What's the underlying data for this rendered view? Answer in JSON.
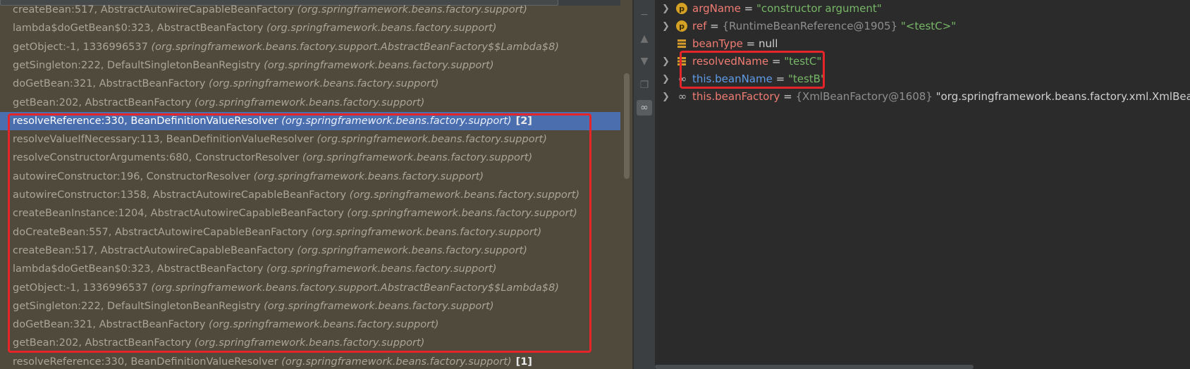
{
  "frames": [
    {
      "method": "createBean:517, AbstractAutowireCapableBeanFactory",
      "pkg": "(org.springframework.beans.factory.support)",
      "badge": ""
    },
    {
      "method": "lambda$doGetBean$0:323, AbstractBeanFactory",
      "pkg": "(org.springframework.beans.factory.support)",
      "badge": ""
    },
    {
      "method": "getObject:-1, 1336996537",
      "pkg": "(org.springframework.beans.factory.support.AbstractBeanFactory$$Lambda$8)",
      "badge": ""
    },
    {
      "method": "getSingleton:222, DefaultSingletonBeanRegistry",
      "pkg": "(org.springframework.beans.factory.support)",
      "badge": ""
    },
    {
      "method": "doGetBean:321, AbstractBeanFactory",
      "pkg": "(org.springframework.beans.factory.support)",
      "badge": ""
    },
    {
      "method": "getBean:202, AbstractBeanFactory",
      "pkg": "(org.springframework.beans.factory.support)",
      "badge": ""
    },
    {
      "method": "resolveReference:330, BeanDefinitionValueResolver",
      "pkg": "(org.springframework.beans.factory.support)",
      "badge": "[2]"
    },
    {
      "method": "resolveValueIfNecessary:113, BeanDefinitionValueResolver",
      "pkg": "(org.springframework.beans.factory.support)",
      "badge": ""
    },
    {
      "method": "resolveConstructorArguments:680, ConstructorResolver",
      "pkg": "(org.springframework.beans.factory.support)",
      "badge": ""
    },
    {
      "method": "autowireConstructor:196, ConstructorResolver",
      "pkg": "(org.springframework.beans.factory.support)",
      "badge": ""
    },
    {
      "method": "autowireConstructor:1358, AbstractAutowireCapableBeanFactory",
      "pkg": "(org.springframework.beans.factory.support)",
      "badge": ""
    },
    {
      "method": "createBeanInstance:1204, AbstractAutowireCapableBeanFactory",
      "pkg": "(org.springframework.beans.factory.support)",
      "badge": ""
    },
    {
      "method": "doCreateBean:557, AbstractAutowireCapableBeanFactory",
      "pkg": "(org.springframework.beans.factory.support)",
      "badge": ""
    },
    {
      "method": "createBean:517, AbstractAutowireCapableBeanFactory",
      "pkg": "(org.springframework.beans.factory.support)",
      "badge": ""
    },
    {
      "method": "lambda$doGetBean$0:323, AbstractBeanFactory",
      "pkg": "(org.springframework.beans.factory.support)",
      "badge": ""
    },
    {
      "method": "getObject:-1, 1336996537",
      "pkg": "(org.springframework.beans.factory.support.AbstractBeanFactory$$Lambda$8)",
      "badge": ""
    },
    {
      "method": "getSingleton:222, DefaultSingletonBeanRegistry",
      "pkg": "(org.springframework.beans.factory.support)",
      "badge": ""
    },
    {
      "method": "doGetBean:321, AbstractBeanFactory",
      "pkg": "(org.springframework.beans.factory.support)",
      "badge": ""
    },
    {
      "method": "getBean:202, AbstractBeanFactory",
      "pkg": "(org.springframework.beans.factory.support)",
      "badge": ""
    },
    {
      "method": "resolveReference:330, BeanDefinitionValueResolver",
      "pkg": "(org.springframework.beans.factory.support)",
      "badge": "[1]"
    }
  ],
  "variables": [
    {
      "icon": "p",
      "name": "argName",
      "eq": " = ",
      "type": "",
      "value": "\"constructor argument\"",
      "blue": false
    },
    {
      "icon": "p",
      "name": "ref",
      "eq": " = ",
      "type": "{RuntimeBeanReference@1905} ",
      "value": "\"<testC>\"",
      "blue": false
    },
    {
      "icon": "field",
      "name": "beanType",
      "eq": " = ",
      "type": "",
      "value": "null",
      "blue": false
    },
    {
      "icon": "field",
      "name": "resolvedName",
      "eq": " = ",
      "type": "",
      "value": "\"testC\"",
      "blue": false
    },
    {
      "icon": "watch",
      "name": "this.beanName",
      "eq": " = ",
      "type": "",
      "value": "\"testB\"",
      "blue": true
    },
    {
      "icon": "watch",
      "name": "this.beanFactory",
      "eq": " = ",
      "type": "{XmlBeanFactory@1608} ",
      "value": "\"org.springframework.beans.factory.xml.XmlBeanFa...",
      "blue": false
    }
  ],
  "icons": {
    "chevron": "chevron-right-icon",
    "p": "parameter-icon",
    "field": "field-icon",
    "watch": "watch-glasses-icon"
  },
  "colors": {
    "highlight_box": "#e5252a",
    "selection": "#4b6eaf",
    "frames_bg": "#4f4a3c",
    "vars_bg": "#2b2b2b"
  }
}
